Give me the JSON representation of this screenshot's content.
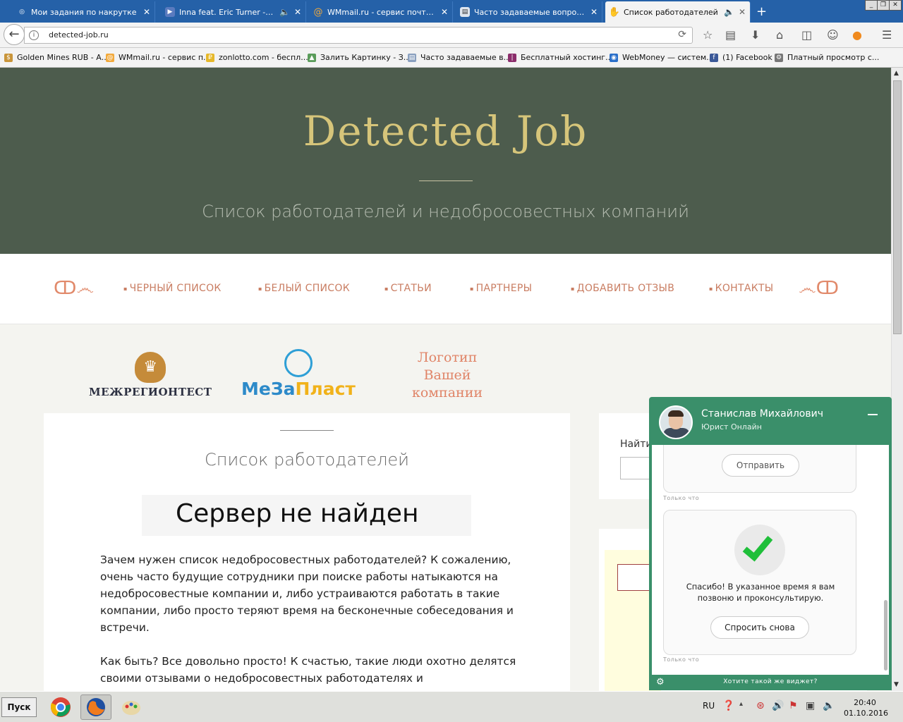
{
  "browser": {
    "tabs": [
      {
        "label": "Мои задания по накрутке",
        "icon": "target-icon",
        "color": "#e9f1fb"
      },
      {
        "label": "Inna feat. Eric Turner - B...",
        "icon": "play-icon",
        "color": "#5a7bbf"
      },
      {
        "label": "WMmail.ru - сервис почтовы...",
        "icon": "at-icon",
        "color": "#f2a93b"
      },
      {
        "label": "Часто задаваемые вопросы...",
        "icon": "page-icon",
        "color": "#dfe6ef"
      },
      {
        "label": "Список работодателей",
        "icon": "hand-icon",
        "color": "#333333"
      }
    ],
    "url": "detected-job.ru",
    "bookmarks": [
      {
        "label": "Golden Mines RUB - А...",
        "color": "#c9953a"
      },
      {
        "label": "WMmail.ru - сервис п...",
        "color": "#f2a93b"
      },
      {
        "label": "zonlotto.com - беспл...",
        "color": "#e6b82a"
      },
      {
        "label": "Залить Картинку - З...",
        "color": "#5a9c5a"
      },
      {
        "label": "Часто задаваемые в...",
        "color": "#8aa0bf"
      },
      {
        "label": "Бесплатный хостинг...",
        "color": "#8b2d6b"
      },
      {
        "label": "WebMoney — систем...",
        "color": "#2a6fc9"
      },
      {
        "label": "(1) Facebook",
        "color": "#3b5998"
      },
      {
        "label": "Платный просмотр с...",
        "color": "#777777"
      }
    ]
  },
  "site": {
    "title": "Detected Job",
    "subtitle": "Список работодателей и недобросовестных компаний",
    "menu": [
      "ЧЕРНЫЙ СПИСОК",
      "БЕЛЫЙ СПИСОК",
      "СТАТЬИ",
      "ПАРТНЕРЫ",
      "ДОБАВИТЬ ОТЗЫВ",
      "КОНТАКТЫ"
    ],
    "partners": {
      "logo1": "МЕЖРЕГИОНТЕСТ",
      "logo2a": "МеЗа",
      "logo2b": "Пласт",
      "logo3": "Логотип Вашей компании"
    },
    "card_title": "Список работодателей",
    "error_text": "Сервер не найден",
    "para1": "Зачем нужен список недобросовестных работодателей? К сожалению, очень часто будущие сотрудники при поиске работы натыкаются на недобросовестные компании и, либо устраиваются работать в такие компании, либо просто теряют время на бесконечные собеседования и встречи.",
    "para2": "Как быть? Все довольно просто! К счастью, такие люди охотно делятся своими отзывами о недобросовестных работодателях и предостерегают",
    "search_label": "Найти"
  },
  "widget": {
    "name": "Станислав Михайлович",
    "role": "Юрист Онлайн",
    "send_button": "Отправить",
    "timestamp": "Только что",
    "thanks": "Спасибо! В указанное время я вам позвоню и проконсультирую.",
    "ask_again": "Спросить снова",
    "footer": "Хотите такой же виджет?"
  },
  "taskbar": {
    "start": "Пуск",
    "lang": "RU",
    "time": "20:40",
    "date": "01.10.2016"
  },
  "colors": {
    "hero_bg": "#4d5c4d",
    "title_gold": "#d6c57a",
    "menu_accent": "#c97d62",
    "widget_green": "#3a8f6a",
    "tab_blue": "#2561a8"
  }
}
